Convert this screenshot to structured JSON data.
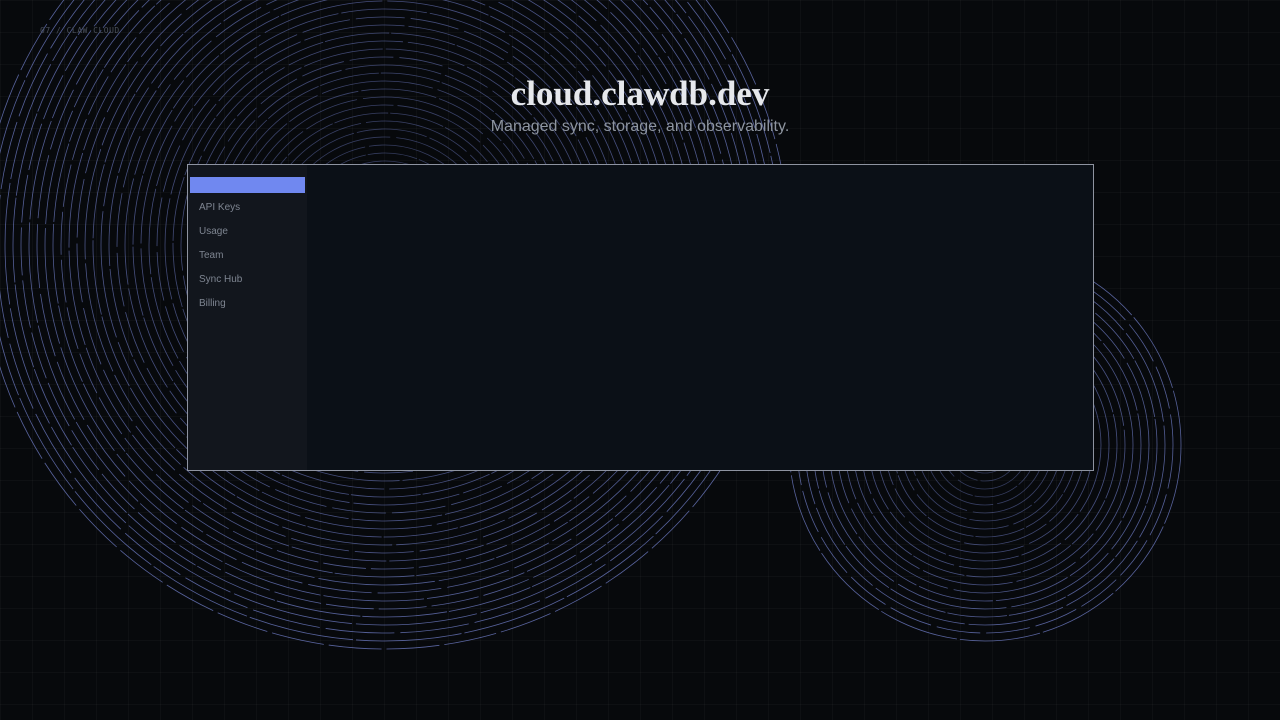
{
  "corner_label": "07 / CLAW CLOUD",
  "hero": {
    "title": "cloud.clawdb.dev",
    "subtitle": "Managed sync, storage, and observability."
  },
  "sidebar": {
    "active_label": "",
    "items": [
      {
        "label": "API Keys"
      },
      {
        "label": "Usage"
      },
      {
        "label": "Team"
      },
      {
        "label": "Sync Hub"
      },
      {
        "label": "Billing"
      }
    ]
  },
  "colors": {
    "background": "#07090c",
    "panel": "#0b1017",
    "sidebar": "#12161d",
    "accent": "#7088f0",
    "rings": "#8fa0ff"
  }
}
